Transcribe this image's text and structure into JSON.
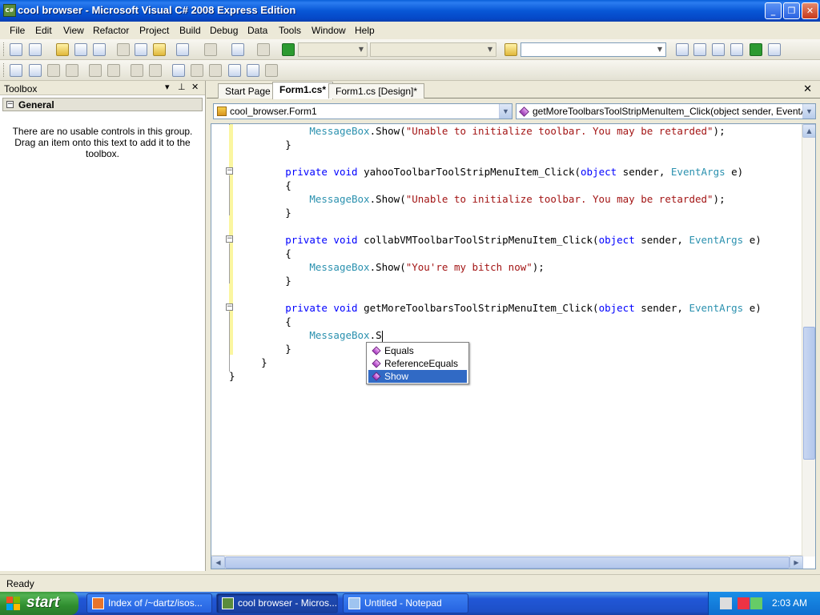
{
  "window": {
    "title": "cool browser - Microsoft Visual C# 2008 Express Edition",
    "app_icon_text": "C#"
  },
  "menu": [
    "File",
    "Edit",
    "View",
    "Refactor",
    "Project",
    "Build",
    "Debug",
    "Data",
    "Tools",
    "Window",
    "Help"
  ],
  "toolbox": {
    "title": "Toolbox",
    "group": "General",
    "empty_message": "There are no usable controls in this group. Drag an item onto this text to add it to the toolbox."
  },
  "tabs": [
    {
      "label": "Start Page",
      "active": false
    },
    {
      "label": "Form1.cs*",
      "active": true
    },
    {
      "label": "Form1.cs [Design]*",
      "active": false
    }
  ],
  "navbar": {
    "class_combo": "cool_browser.Form1",
    "member_combo": "getMoreToolbarsToolStripMenuItem_Click(object sender, EventArgs e"
  },
  "code": {
    "l1_call_obj": "MessageBox",
    "l1_call_method": ".Show(",
    "l1_str": "\"Unable to initialize toolbar. You may be retarded\"",
    "l1_end": ");",
    "brace_close": "}",
    "brace_open": "{",
    "m2_name": " yahooToolbarToolStripMenuItem_Click(",
    "m3_name": " collabVMToolbarToolStripMenuItem_Click(",
    "m4_name": " getMoreToolbarsToolStripMenuItem_Click(",
    "kw_private": "private",
    "kw_void": " void",
    "kw_object": "object",
    "param_sender": " sender, ",
    "type_eventargs": "EventArgs",
    "param_e": " e)",
    "l3_str": "\"You're my bitch now\"",
    "typing": ".S"
  },
  "intellisense": {
    "items": [
      "Equals",
      "ReferenceEquals",
      "Show"
    ],
    "selected": "Show"
  },
  "status": "Ready",
  "taskbar": {
    "start": "start",
    "items": [
      {
        "label": "Index of /~dartz/isos...",
        "active": false
      },
      {
        "label": "cool browser - Micros...",
        "active": true
      },
      {
        "label": "Untitled - Notepad",
        "active": false
      }
    ],
    "clock": "2:03 AM"
  },
  "colors": {
    "keyword": "#0000ff",
    "type": "#2b91af",
    "string": "#a31515",
    "selection": "#316ac5",
    "titlebar": "#0857d6"
  }
}
